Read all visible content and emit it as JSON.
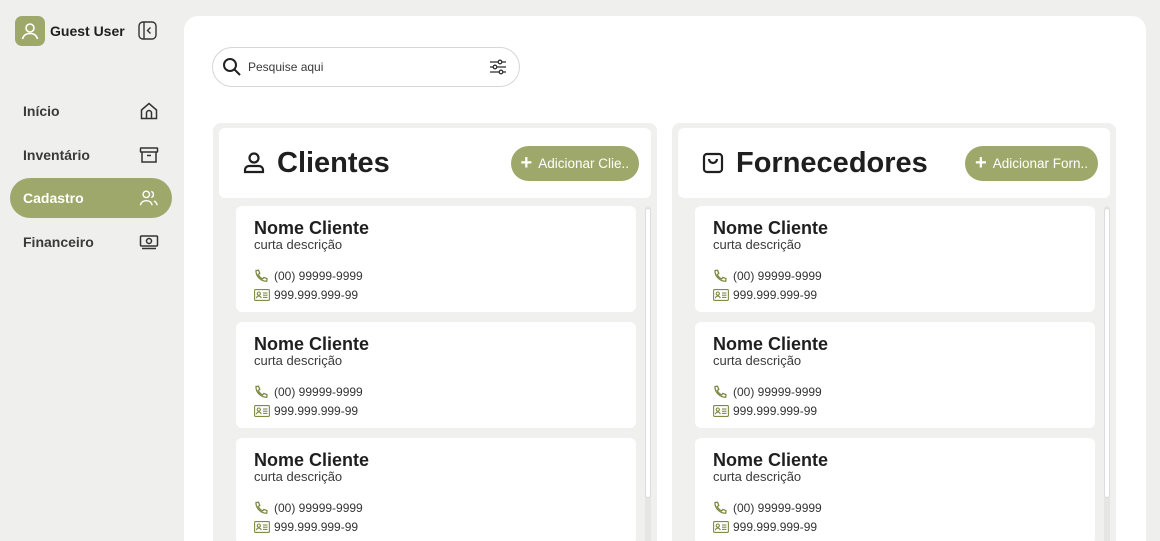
{
  "user": {
    "name": "Guest User"
  },
  "nav": [
    {
      "label": "Início",
      "icon": "home-icon",
      "active": false
    },
    {
      "label": "Inventário",
      "icon": "archive-box-icon",
      "active": false
    },
    {
      "label": "Cadastro",
      "icon": "users-icon",
      "active": true
    },
    {
      "label": "Financeiro",
      "icon": "banknote-icon",
      "active": false
    }
  ],
  "search": {
    "placeholder": "Pesquise aqui",
    "value": ""
  },
  "clients": {
    "title": "Clientes",
    "add_label": "Adicionar Clie..",
    "items": [
      {
        "name": "Nome Cliente",
        "desc": "curta descrição",
        "phone": "(00) 99999-9999",
        "doc": "999.999.999-99"
      },
      {
        "name": "Nome Cliente",
        "desc": "curta descrição",
        "phone": "(00) 99999-9999",
        "doc": "999.999.999-99"
      },
      {
        "name": "Nome Cliente",
        "desc": "curta descrição",
        "phone": "(00) 99999-9999",
        "doc": "999.999.999-99"
      }
    ]
  },
  "suppliers": {
    "title": "Fornecedores",
    "add_label": "Adicionar Forn..",
    "items": [
      {
        "name": "Nome Cliente",
        "desc": "curta descrição",
        "phone": "(00) 99999-9999",
        "doc": "999.999.999-99"
      },
      {
        "name": "Nome Cliente",
        "desc": "curta descrição",
        "phone": "(00) 99999-9999",
        "doc": "999.999.999-99"
      },
      {
        "name": "Nome Cliente",
        "desc": "curta descrição",
        "phone": "(00) 99999-9999",
        "doc": "999.999.999-99"
      }
    ]
  },
  "colors": {
    "accent": "#9fa86b",
    "background": "#efefed",
    "surface": "#ffffff"
  }
}
